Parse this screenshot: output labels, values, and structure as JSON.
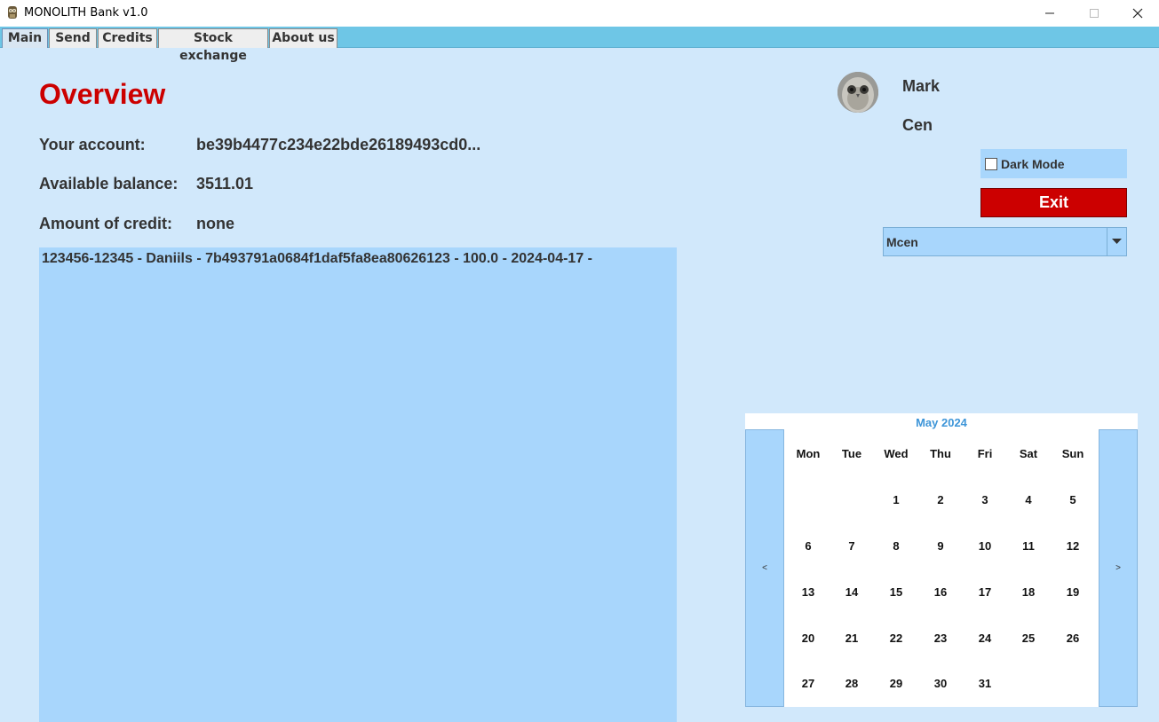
{
  "window": {
    "title": "MONOLITH Bank v1.0",
    "minimize_icon": "minimize-icon",
    "maximize_icon": "maximize-icon",
    "close_icon": "close-icon"
  },
  "tabs": [
    {
      "label": "Main",
      "active": true
    },
    {
      "label": "Send",
      "active": false
    },
    {
      "label": "Credits",
      "active": false
    },
    {
      "label": "Stock exchange",
      "active": false
    },
    {
      "label": "About us",
      "active": false
    }
  ],
  "overview": {
    "title": "Overview",
    "account_label": "Your account:",
    "account_value": "be39b4477c234e22bde26189493cd0...",
    "balance_label": "Available balance:",
    "balance_value": "3511.01",
    "credit_label": "Amount of credit:",
    "credit_value": "none"
  },
  "transactions": [
    "123456-12345 - Daniils - 7b493791a0684f1daf5fa8ea80626123 - 100.0 - 2024-04-17 -"
  ],
  "user": {
    "first_name": "Mark",
    "last_name": "Cen",
    "avatar_icon": "owl-avatar-icon"
  },
  "controls": {
    "dark_mode_label": "Dark Mode",
    "dark_mode_checked": false,
    "exit_label": "Exit",
    "account_select_value": "Mcen"
  },
  "calendar": {
    "title": "May 2024",
    "prev_label": "<",
    "next_label": ">",
    "weekdays": [
      "Mon",
      "Tue",
      "Wed",
      "Thu",
      "Fri",
      "Sat",
      "Sun"
    ],
    "weeks": [
      [
        "",
        "",
        "1",
        "2",
        "3",
        "4",
        "5"
      ],
      [
        "6",
        "7",
        "8",
        "9",
        "10",
        "11",
        "12"
      ],
      [
        "13",
        "14",
        "15",
        "16",
        "17",
        "18",
        "19"
      ],
      [
        "20",
        "21",
        "22",
        "23",
        "24",
        "25",
        "26"
      ],
      [
        "27",
        "28",
        "29",
        "30",
        "31",
        "",
        ""
      ]
    ]
  },
  "colors": {
    "background": "#d1e8fb",
    "panel": "#a8d6fc",
    "accent_red": "#cc0000",
    "tabbar": "#6ec6e6",
    "calendar_title": "#3d95d8"
  }
}
